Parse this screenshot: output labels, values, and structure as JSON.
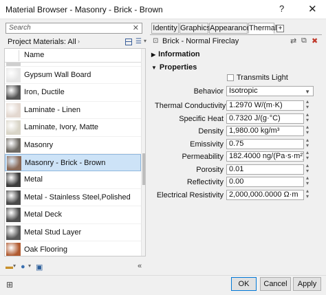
{
  "window": {
    "title": "Material Browser - Masonry - Brick - Brown",
    "help": "?",
    "close": "✕"
  },
  "search": {
    "placeholder": "Search"
  },
  "library": {
    "label": "Project Materials: All",
    "caret": "›"
  },
  "list": {
    "header": "Name",
    "items": [
      {
        "name": "Gypsum Wall Board",
        "color": "#e6e6e6"
      },
      {
        "name": "Iron, Ductile",
        "color": "#555555"
      },
      {
        "name": "Laminate - Linen",
        "color": "#e3d8d0"
      },
      {
        "name": "Laminate, Ivory, Matte",
        "color": "#d9d5c8"
      },
      {
        "name": "Masonry",
        "color": "#6e6a64"
      },
      {
        "name": "Masonry - Brick - Brown",
        "color": "#8a6a58"
      },
      {
        "name": "Metal",
        "color": "#3c3c3c"
      },
      {
        "name": "Metal - Stainless Steel,Polished",
        "color": "#4a4a4a"
      },
      {
        "name": "Metal Deck",
        "color": "#4e4e4e"
      },
      {
        "name": "Metal Stud Layer",
        "color": "#585858"
      },
      {
        "name": "Oak Flooring",
        "color": "#b05a30"
      }
    ],
    "selected_index": 5
  },
  "bottombar": {
    "collapse": "«"
  },
  "tabs": [
    {
      "label": "Identity"
    },
    {
      "label": "Graphics"
    },
    {
      "label": "Appearance"
    },
    {
      "label": "Thermal",
      "active": true
    }
  ],
  "tab_add": "+",
  "asset": {
    "name": "Brick - Normal Fireclay"
  },
  "sections": {
    "information": "Information",
    "properties": "Properties"
  },
  "transmits_light": {
    "label": "Transmits Light",
    "checked": false
  },
  "behavior": {
    "label": "Behavior",
    "value": "Isotropic"
  },
  "properties": [
    {
      "label": "Thermal Conductivity",
      "value": "1.2970 W/(m·K)"
    },
    {
      "label": "Specific Heat",
      "value": "0.7320 J/(g·°C)"
    },
    {
      "label": "Density",
      "value": "1,980.00 kg/m³"
    },
    {
      "label": "Emissivity",
      "value": "0.75"
    },
    {
      "label": "Permeability",
      "value": "182.4000 ng/(Pa·s·m²)"
    },
    {
      "label": "Porosity",
      "value": "0.01"
    },
    {
      "label": "Reflectivity",
      "value": "0.00"
    },
    {
      "label": "Electrical Resistivity",
      "value": "2,000,000.0000 Ω·m"
    }
  ],
  "buttons": {
    "ok": "OK",
    "cancel": "Cancel",
    "apply": "Apply"
  }
}
